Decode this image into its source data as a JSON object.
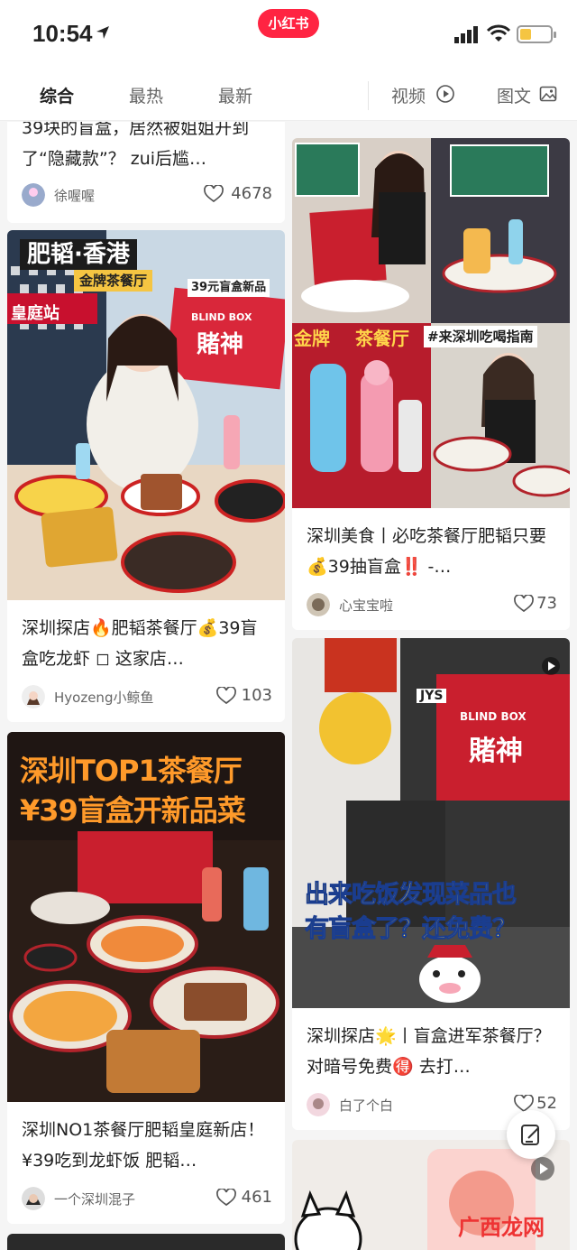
{
  "status": {
    "time": "10:54",
    "app_badge": "小红书"
  },
  "tabs": {
    "comprehensive": "综合",
    "hottest": "最热",
    "latest": "最新",
    "video": "视频",
    "image_text": "图文"
  },
  "cards": [
    {
      "title": "39块的盲盒，居然被姐姐开到了“隐藏款”？ zui后尴…",
      "author": "徐喔喔",
      "likes": "4678"
    },
    {
      "title": "深圳探店🔥肥韬茶餐厅💰39盲盒吃龙虾 ◻ 这家店…",
      "author": "Hyozeng小鲸鱼",
      "likes": "103",
      "image_text": {
        "headline": "肥韬·香港",
        "sub": "金牌茶餐厅",
        "box_brand": "BLIND BOX",
        "box_cn": "賭神",
        "tag": "39元盲盒新品",
        "side_sign": "皇庭站"
      }
    },
    {
      "title": "深圳NO1茶餐厅肥韬皇庭新店！¥39吃到龙虾饭 肥韬…",
      "author": "一个深圳混子",
      "likes": "461",
      "image_text": {
        "line1": "深圳TOP1茶餐厅",
        "line2": "¥39盲盒开新品菜"
      }
    },
    {
      "title": "深圳美食丨必吃茶餐厅肥韬只要💰39抽盲盒‼️ -…",
      "author": "心宝宝啦",
      "likes": "73",
      "image_text": {
        "tag1": "金牌",
        "tag2": "茶餐厅",
        "tag3": "#来深圳吃喝指南"
      }
    },
    {
      "title": "深圳探店🌟丨盲盒进军茶餐厅？对暗号免费🉐 去打…",
      "author": "白了个白",
      "likes": "52",
      "image_text": {
        "line1": "出来吃饭发现菜品也",
        "line2": "有盲盒了？还免费？",
        "box_brand": "BLIND BOX",
        "box_cn": "賭神",
        "jys": "JYS"
      }
    }
  ],
  "watermark": "广西龙网",
  "colors": {
    "brand": "#ff2442",
    "accent_yellow": "#f5c542"
  }
}
